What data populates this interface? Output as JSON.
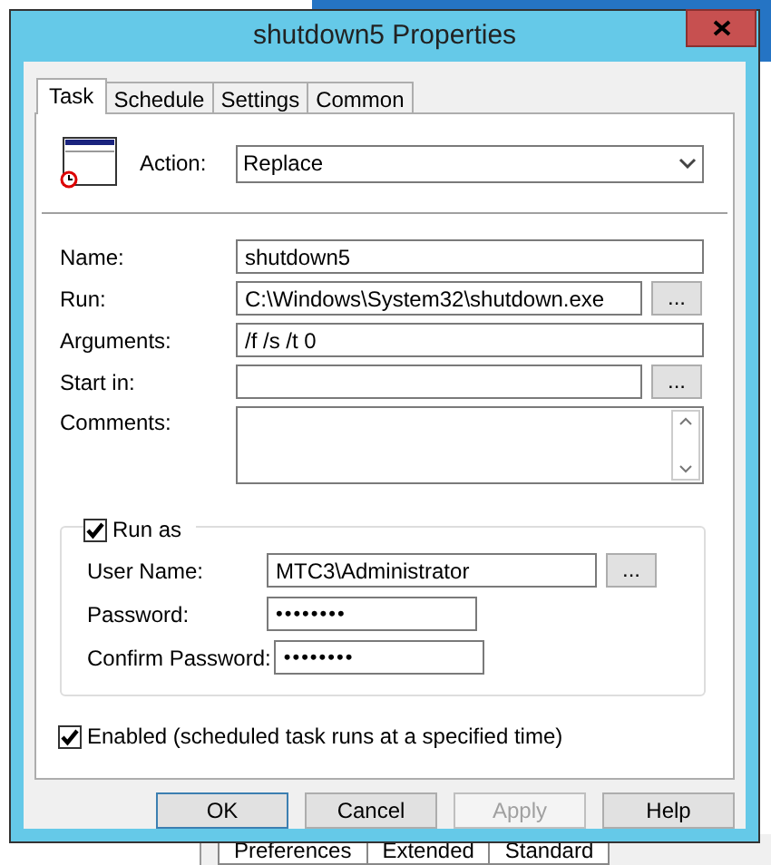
{
  "background_tabs": [
    {
      "label": "Preferences"
    },
    {
      "label": "Extended"
    },
    {
      "label": "Standard"
    }
  ],
  "window": {
    "title": "shutdown5 Properties"
  },
  "tabs": [
    {
      "label": "Task",
      "selected": true
    },
    {
      "label": "Schedule",
      "selected": false
    },
    {
      "label": "Settings",
      "selected": false
    },
    {
      "label": "Common",
      "selected": false
    }
  ],
  "action": {
    "label": "Action:",
    "value": "Replace"
  },
  "fields": [
    {
      "label": "Name:",
      "value": "shutdown5"
    },
    {
      "label": "Run:",
      "value": "C:\\Windows\\System32\\shutdown.exe",
      "browse_label": "..."
    },
    {
      "label": "Arguments:",
      "value": "/f /s /t 0"
    },
    {
      "label": "Start in:",
      "browse_label": "..."
    }
  ],
  "comments": {
    "label": "Comments:"
  },
  "run_as": {
    "label": "Run as",
    "checked": true,
    "fields": [
      {
        "label": "User Name:",
        "value": "MTC3\\Administrator",
        "kind": "text",
        "browse_label": "..."
      },
      {
        "label": "Password:",
        "value": "••••••••",
        "kind": "password"
      },
      {
        "label": "Confirm Password:",
        "value": "••••••••",
        "kind": "password"
      }
    ]
  },
  "enabled": {
    "label": "Enabled (scheduled task runs at a specified time)",
    "checked": true
  },
  "buttons": [
    {
      "label": "OK",
      "disabled": false,
      "default": true
    },
    {
      "label": "Cancel",
      "disabled": false,
      "default": false
    },
    {
      "label": "Apply",
      "disabled": true,
      "default": false
    },
    {
      "label": "Help",
      "disabled": false,
      "default": false
    }
  ]
}
